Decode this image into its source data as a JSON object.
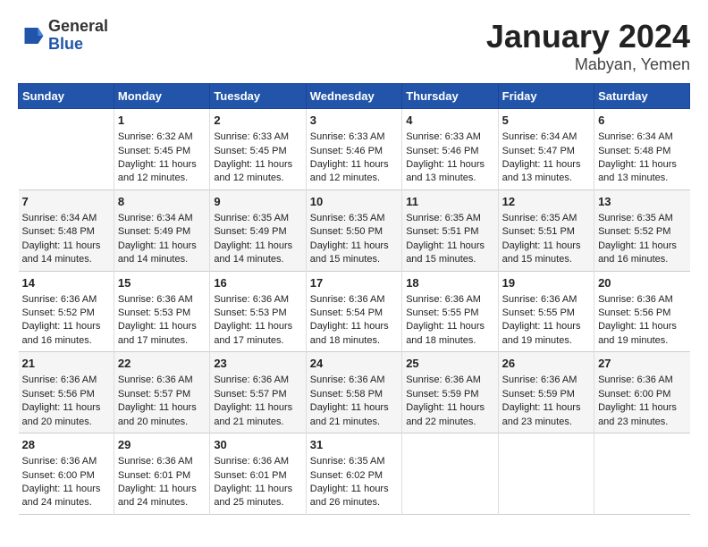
{
  "logo": {
    "general": "General",
    "blue": "Blue"
  },
  "title": "January 2024",
  "subtitle": "Mabyan, Yemen",
  "columns": [
    "Sunday",
    "Monday",
    "Tuesday",
    "Wednesday",
    "Thursday",
    "Friday",
    "Saturday"
  ],
  "weeks": [
    [
      {
        "day": "",
        "content": ""
      },
      {
        "day": "1",
        "content": "Sunrise: 6:32 AM\nSunset: 5:45 PM\nDaylight: 11 hours\nand 12 minutes."
      },
      {
        "day": "2",
        "content": "Sunrise: 6:33 AM\nSunset: 5:45 PM\nDaylight: 11 hours\nand 12 minutes."
      },
      {
        "day": "3",
        "content": "Sunrise: 6:33 AM\nSunset: 5:46 PM\nDaylight: 11 hours\nand 12 minutes."
      },
      {
        "day": "4",
        "content": "Sunrise: 6:33 AM\nSunset: 5:46 PM\nDaylight: 11 hours\nand 13 minutes."
      },
      {
        "day": "5",
        "content": "Sunrise: 6:34 AM\nSunset: 5:47 PM\nDaylight: 11 hours\nand 13 minutes."
      },
      {
        "day": "6",
        "content": "Sunrise: 6:34 AM\nSunset: 5:48 PM\nDaylight: 11 hours\nand 13 minutes."
      }
    ],
    [
      {
        "day": "7",
        "content": "Sunrise: 6:34 AM\nSunset: 5:48 PM\nDaylight: 11 hours\nand 14 minutes."
      },
      {
        "day": "8",
        "content": "Sunrise: 6:34 AM\nSunset: 5:49 PM\nDaylight: 11 hours\nand 14 minutes."
      },
      {
        "day": "9",
        "content": "Sunrise: 6:35 AM\nSunset: 5:49 PM\nDaylight: 11 hours\nand 14 minutes."
      },
      {
        "day": "10",
        "content": "Sunrise: 6:35 AM\nSunset: 5:50 PM\nDaylight: 11 hours\nand 15 minutes."
      },
      {
        "day": "11",
        "content": "Sunrise: 6:35 AM\nSunset: 5:51 PM\nDaylight: 11 hours\nand 15 minutes."
      },
      {
        "day": "12",
        "content": "Sunrise: 6:35 AM\nSunset: 5:51 PM\nDaylight: 11 hours\nand 15 minutes."
      },
      {
        "day": "13",
        "content": "Sunrise: 6:35 AM\nSunset: 5:52 PM\nDaylight: 11 hours\nand 16 minutes."
      }
    ],
    [
      {
        "day": "14",
        "content": "Sunrise: 6:36 AM\nSunset: 5:52 PM\nDaylight: 11 hours\nand 16 minutes."
      },
      {
        "day": "15",
        "content": "Sunrise: 6:36 AM\nSunset: 5:53 PM\nDaylight: 11 hours\nand 17 minutes."
      },
      {
        "day": "16",
        "content": "Sunrise: 6:36 AM\nSunset: 5:53 PM\nDaylight: 11 hours\nand 17 minutes."
      },
      {
        "day": "17",
        "content": "Sunrise: 6:36 AM\nSunset: 5:54 PM\nDaylight: 11 hours\nand 18 minutes."
      },
      {
        "day": "18",
        "content": "Sunrise: 6:36 AM\nSunset: 5:55 PM\nDaylight: 11 hours\nand 18 minutes."
      },
      {
        "day": "19",
        "content": "Sunrise: 6:36 AM\nSunset: 5:55 PM\nDaylight: 11 hours\nand 19 minutes."
      },
      {
        "day": "20",
        "content": "Sunrise: 6:36 AM\nSunset: 5:56 PM\nDaylight: 11 hours\nand 19 minutes."
      }
    ],
    [
      {
        "day": "21",
        "content": "Sunrise: 6:36 AM\nSunset: 5:56 PM\nDaylight: 11 hours\nand 20 minutes."
      },
      {
        "day": "22",
        "content": "Sunrise: 6:36 AM\nSunset: 5:57 PM\nDaylight: 11 hours\nand 20 minutes."
      },
      {
        "day": "23",
        "content": "Sunrise: 6:36 AM\nSunset: 5:57 PM\nDaylight: 11 hours\nand 21 minutes."
      },
      {
        "day": "24",
        "content": "Sunrise: 6:36 AM\nSunset: 5:58 PM\nDaylight: 11 hours\nand 21 minutes."
      },
      {
        "day": "25",
        "content": "Sunrise: 6:36 AM\nSunset: 5:59 PM\nDaylight: 11 hours\nand 22 minutes."
      },
      {
        "day": "26",
        "content": "Sunrise: 6:36 AM\nSunset: 5:59 PM\nDaylight: 11 hours\nand 23 minutes."
      },
      {
        "day": "27",
        "content": "Sunrise: 6:36 AM\nSunset: 6:00 PM\nDaylight: 11 hours\nand 23 minutes."
      }
    ],
    [
      {
        "day": "28",
        "content": "Sunrise: 6:36 AM\nSunset: 6:00 PM\nDaylight: 11 hours\nand 24 minutes."
      },
      {
        "day": "29",
        "content": "Sunrise: 6:36 AM\nSunset: 6:01 PM\nDaylight: 11 hours\nand 24 minutes."
      },
      {
        "day": "30",
        "content": "Sunrise: 6:36 AM\nSunset: 6:01 PM\nDaylight: 11 hours\nand 25 minutes."
      },
      {
        "day": "31",
        "content": "Sunrise: 6:35 AM\nSunset: 6:02 PM\nDaylight: 11 hours\nand 26 minutes."
      },
      {
        "day": "",
        "content": ""
      },
      {
        "day": "",
        "content": ""
      },
      {
        "day": "",
        "content": ""
      }
    ]
  ]
}
